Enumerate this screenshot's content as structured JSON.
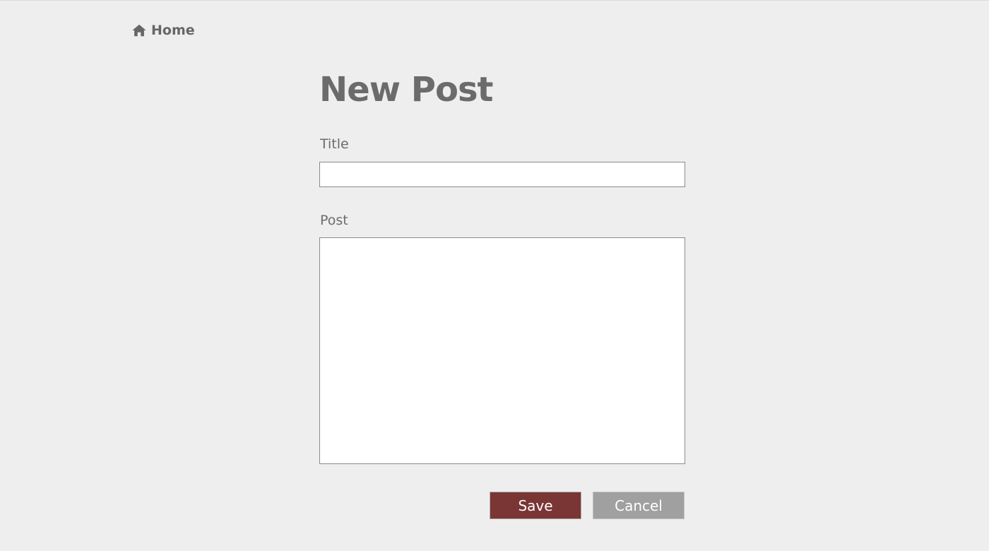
{
  "nav": {
    "home_label": "Home",
    "home_icon": "home-icon"
  },
  "page": {
    "title": "New Post"
  },
  "form": {
    "title_label": "Title",
    "title_value": "",
    "post_label": "Post",
    "post_value": "",
    "save_label": "Save",
    "cancel_label": "Cancel"
  },
  "colors": {
    "background": "#eeeeee",
    "save_button": "#7a3535",
    "cancel_button": "#a0a0a0",
    "text": "#6b6b6b"
  }
}
